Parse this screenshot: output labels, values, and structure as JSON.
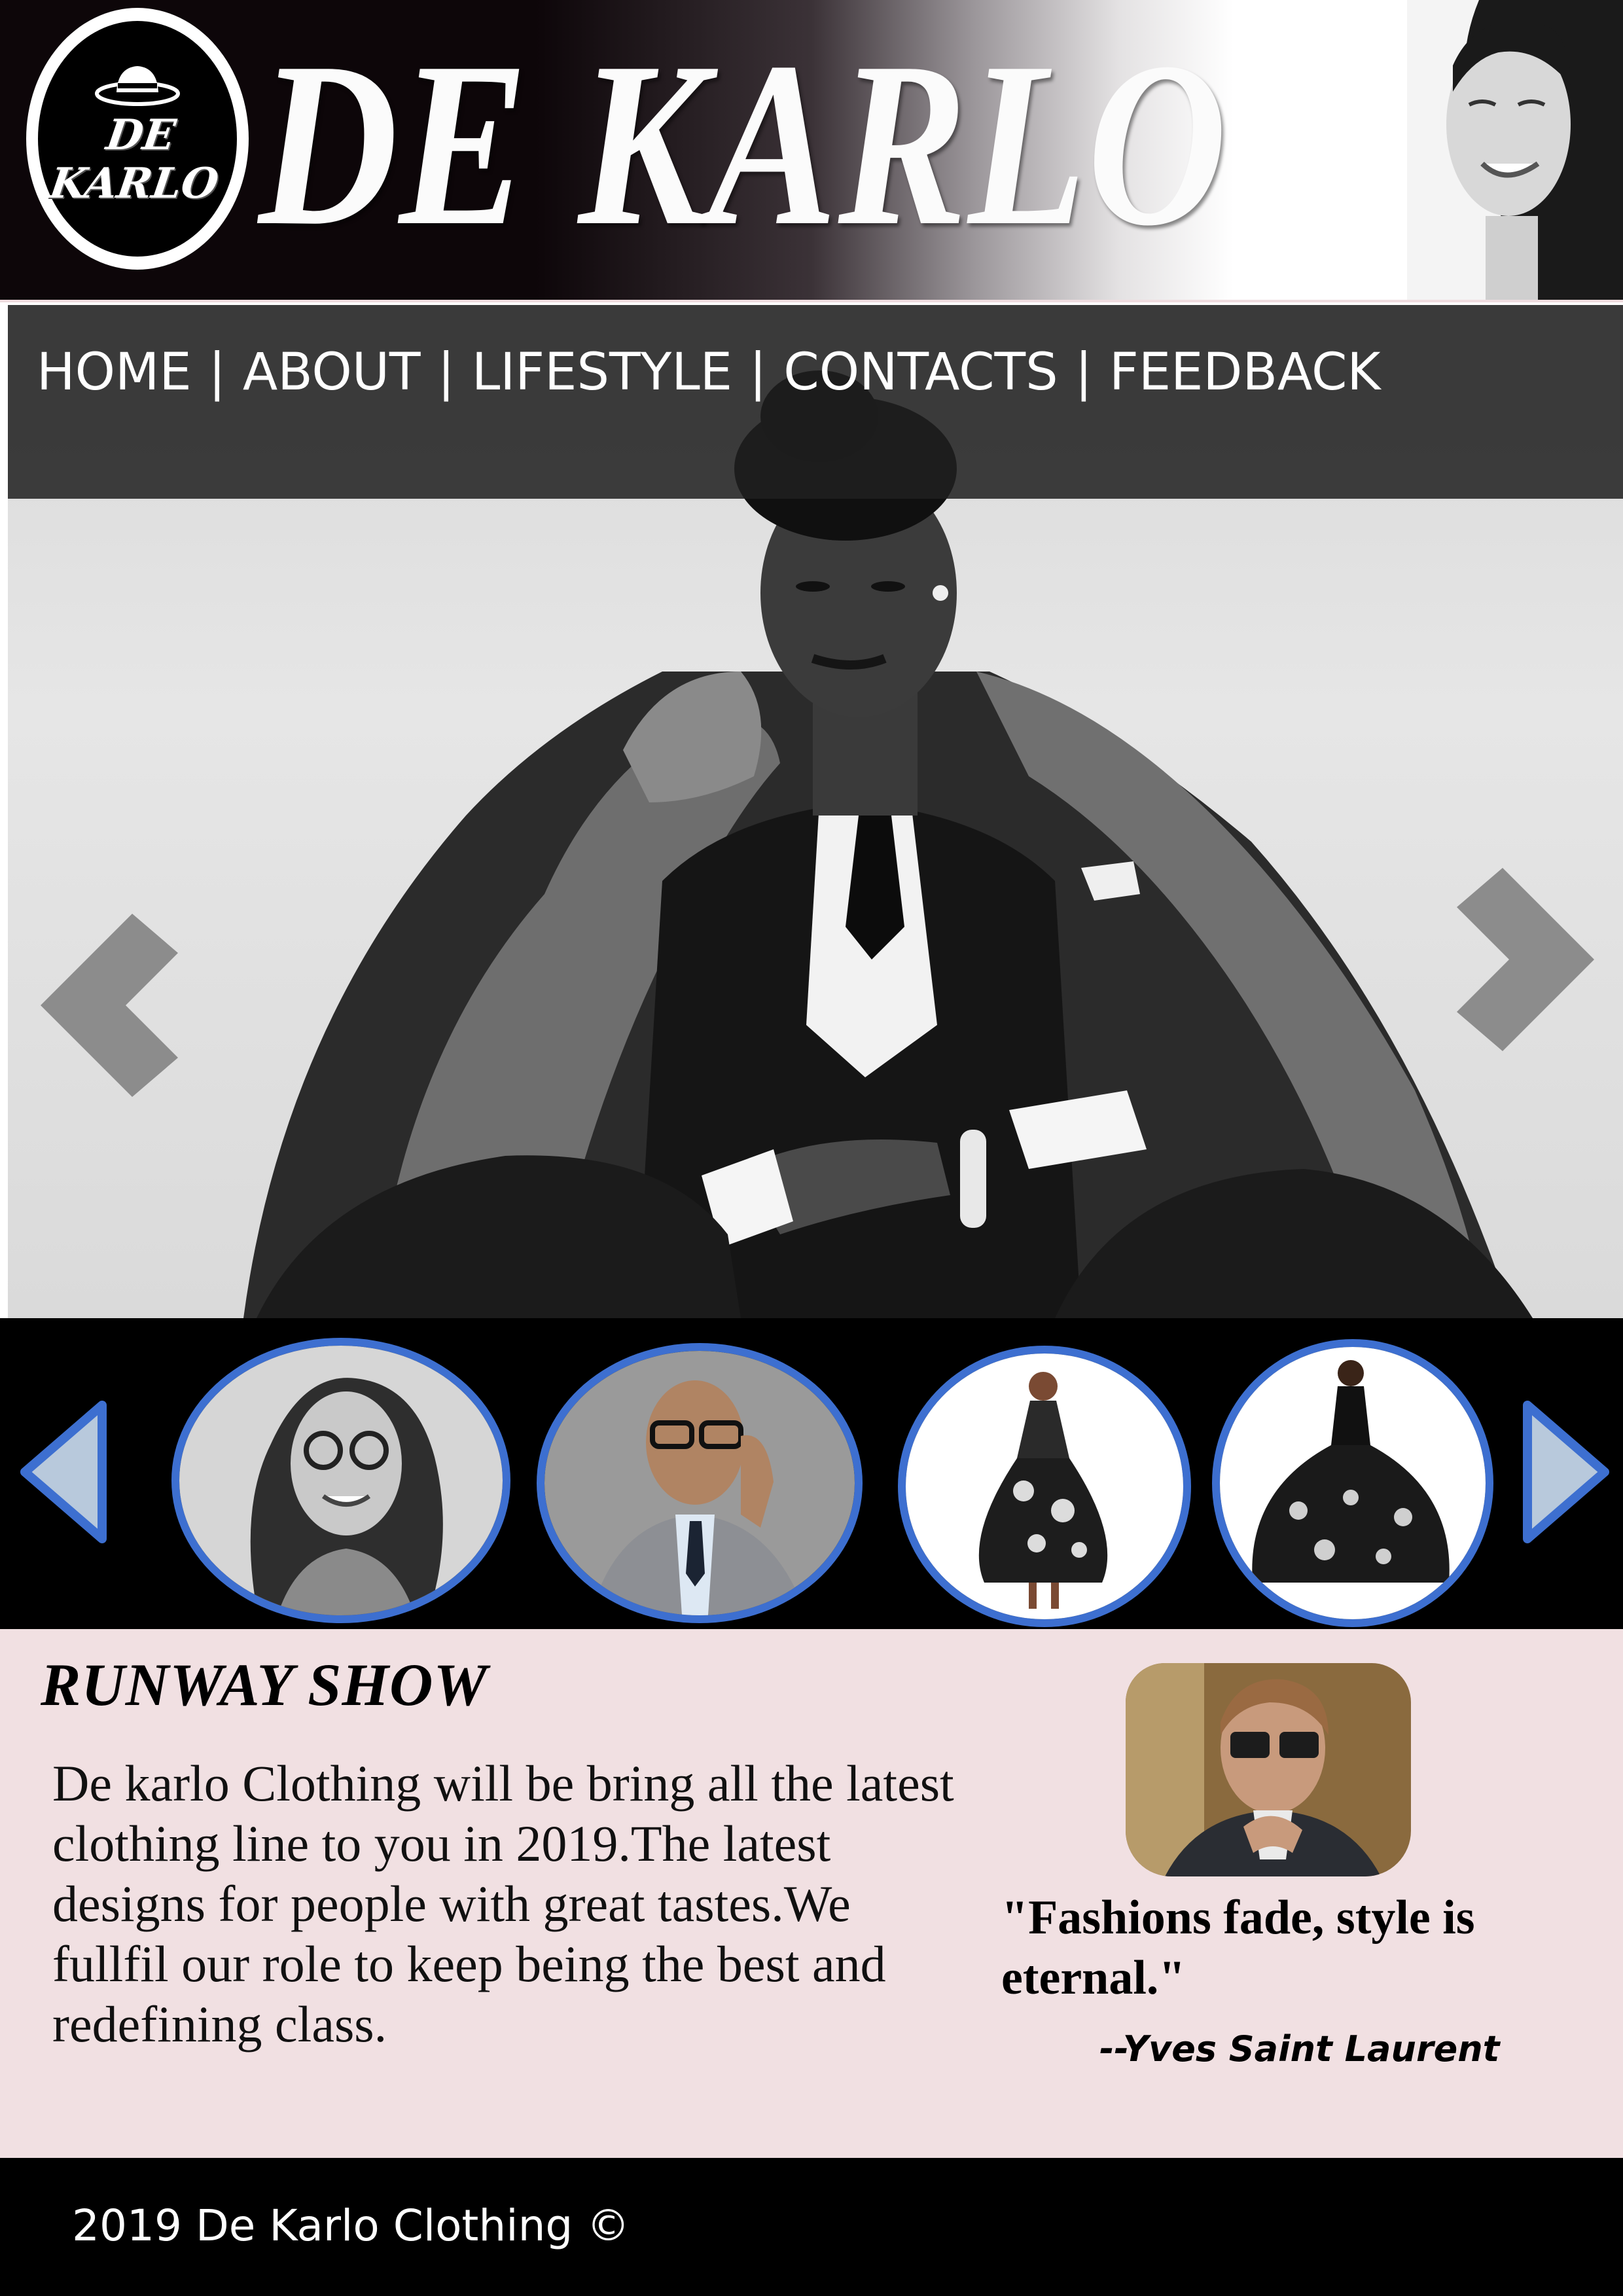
{
  "brand": {
    "logo_text_line1": "DE",
    "logo_text_line2": "KARLO",
    "title": "DE KARLO"
  },
  "nav": {
    "items": [
      {
        "label": "HOME"
      },
      {
        "label": "ABOUT"
      },
      {
        "label": "LIFESTYLE"
      },
      {
        "label": "CONTACTS"
      },
      {
        "label": "FEEDBACK"
      }
    ],
    "separator": "|"
  },
  "hero": {
    "prev_icon": "chevron-left-icon",
    "next_icon": "chevron-right-icon"
  },
  "carousel": {
    "prev_icon": "triangle-left-icon",
    "next_icon": "triangle-right-icon",
    "thumbnails": [
      {
        "icon": "woman-glasses-portrait"
      },
      {
        "icon": "man-suit-portrait"
      },
      {
        "icon": "floral-dress-model"
      },
      {
        "icon": "patterned-gown-model"
      }
    ],
    "ring_color": "#3d6fd0"
  },
  "runway": {
    "title": "RUNWAY SHOW",
    "body": "De karlo  Clothing will be bring all the latest clothing line to you in 2019.The latest designs for people with great tastes.We fullfil our role to keep being the  best and redefining class.",
    "quote": "\"Fashions fade, style is eternal.\"",
    "quote_author": "--Yves Saint Laurent",
    "background": "#f1e0e2"
  },
  "footer": {
    "text": "2019 De Karlo Clothing ©"
  }
}
